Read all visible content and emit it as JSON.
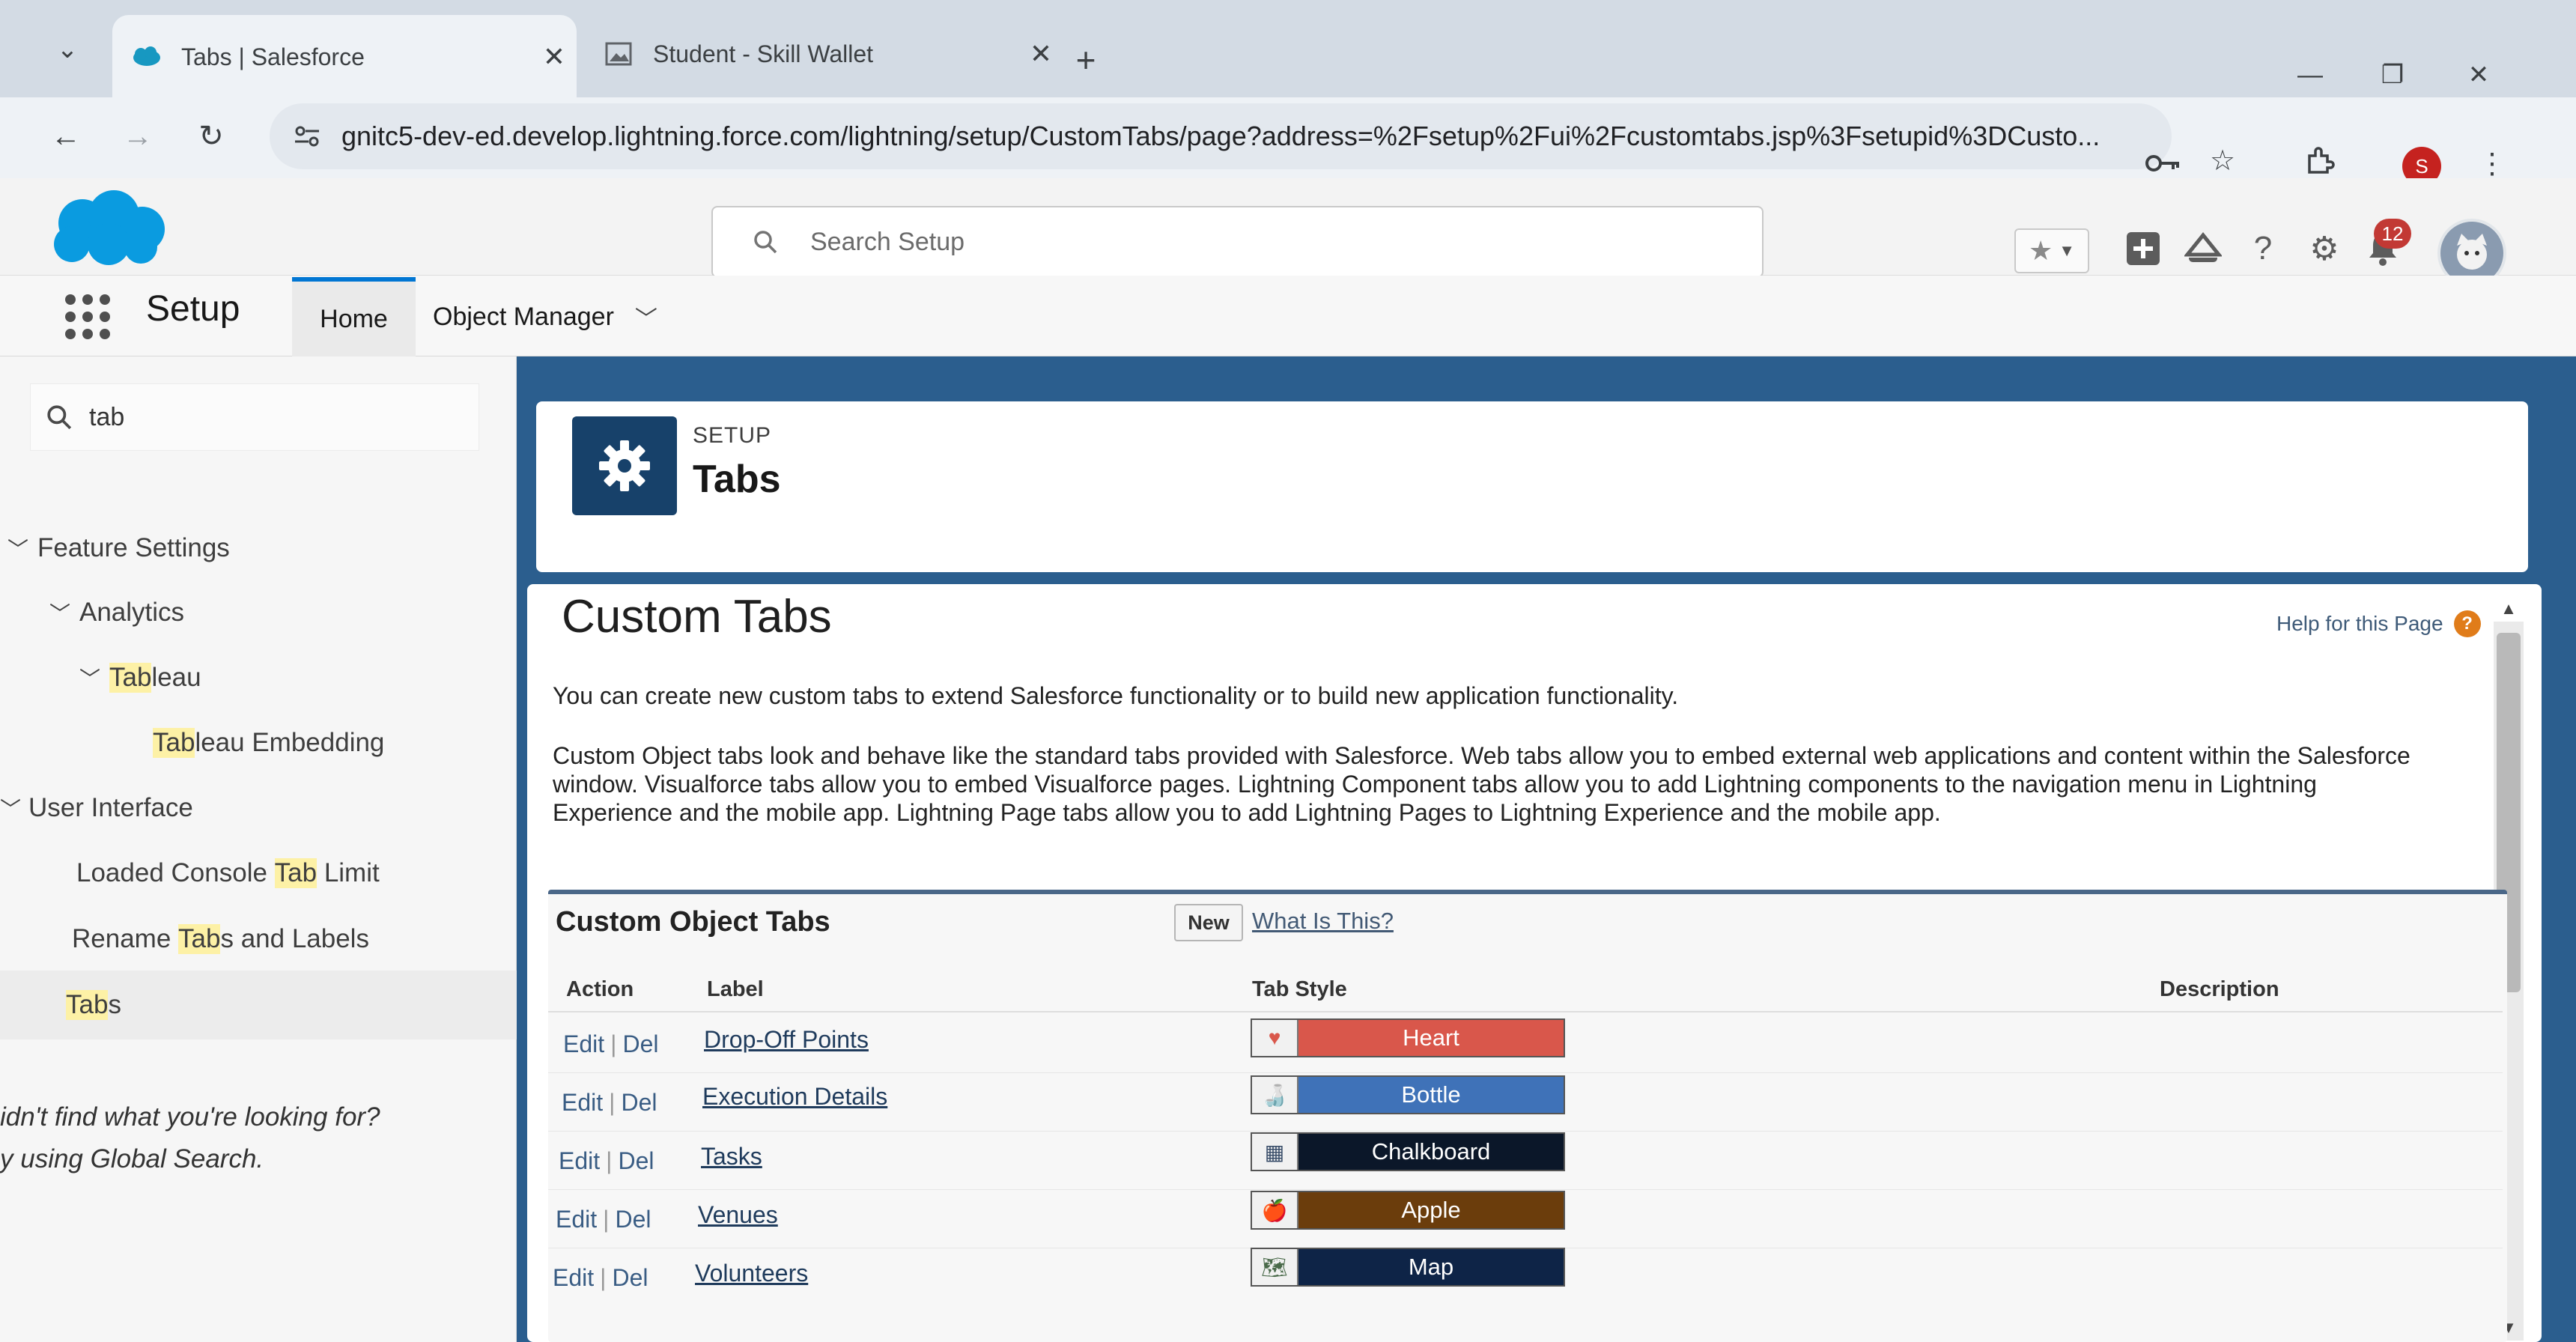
{
  "browser": {
    "tabs": [
      {
        "title": "Tabs | Salesforce",
        "active": true
      },
      {
        "title": "Student - Skill Wallet",
        "active": false
      }
    ],
    "url": "gnitc5-dev-ed.develop.lightning.force.com/lightning/setup/CustomTabs/page?address=%2Fsetup%2Fui%2Fcustomtabs.jsp%3Fsetupid%3DCusto...",
    "profile_initial": "S"
  },
  "header": {
    "search_placeholder": "Search Setup",
    "notification_count": "12"
  },
  "nav": {
    "app_name": "Setup",
    "home": "Home",
    "object_manager": "Object Manager"
  },
  "sidebar": {
    "search_value": "tab",
    "items": [
      {
        "pre": "",
        "hl": "",
        "post": "Feature Settings"
      },
      {
        "pre": "",
        "hl": "",
        "post": "Analytics"
      },
      {
        "pre": "",
        "hl": "Tab",
        "post": "leau"
      },
      {
        "pre": "",
        "hl": "Tab",
        "post": "leau Embedding"
      },
      {
        "pre": "",
        "hl": "",
        "post": "User Interface"
      },
      {
        "pre": "Loaded Console ",
        "hl": "Tab",
        "post": " Limit"
      },
      {
        "pre": "Rename ",
        "hl": "Tab",
        "post": "s and Labels"
      },
      {
        "pre": "",
        "hl": "Tab",
        "post": "s"
      }
    ],
    "not_found_line1": "idn't find what you're looking for?",
    "not_found_line2": "y using Global Search."
  },
  "setup_header": {
    "eyebrow": "SETUP",
    "title": "Tabs"
  },
  "page": {
    "title": "Custom Tabs",
    "help_link": "Help for this Page",
    "intro": "You can create new custom tabs to extend Salesforce functionality or to build new application functionality.",
    "desc_line1": "Custom Object tabs look and behave like the standard tabs provided with Salesforce. Web tabs allow you to embed external web applications and content within the Salesforce",
    "desc_line2": "window. Visualforce tabs allow you to embed Visualforce pages. Lightning Component tabs allow you to add Lightning components to the navigation menu in Lightning",
    "desc_line3": "Experience and the mobile app. Lightning Page tabs allow you to add Lightning Pages to Lightning Experience and the mobile app."
  },
  "custom_object_tabs": {
    "title": "Custom Object Tabs",
    "new_button": "New",
    "what_is_this": "What Is This?",
    "columns": [
      "Action",
      "Label",
      "Tab Style",
      "Description"
    ],
    "edit_label": "Edit",
    "del_label": "Del",
    "rows": [
      {
        "label": "Drop-Off Points",
        "style": "Heart",
        "color": "#d9574b",
        "icon": "heart-icon",
        "glyph": "♥"
      },
      {
        "label": "Execution Details",
        "style": "Bottle",
        "color": "#3f72b8",
        "icon": "bottle-icon",
        "glyph": "🍶"
      },
      {
        "label": "Tasks",
        "style": "Chalkboard",
        "color": "#0b1729",
        "icon": "chalkboard-icon",
        "glyph": "▦"
      },
      {
        "label": "Venues",
        "style": "Apple",
        "color": "#6b3d0c",
        "icon": "apple-icon",
        "glyph": "🍎"
      },
      {
        "label": "Volunteers",
        "style": "Map",
        "color": "#0e2447",
        "icon": "map-icon",
        "glyph": "🗺"
      }
    ]
  }
}
